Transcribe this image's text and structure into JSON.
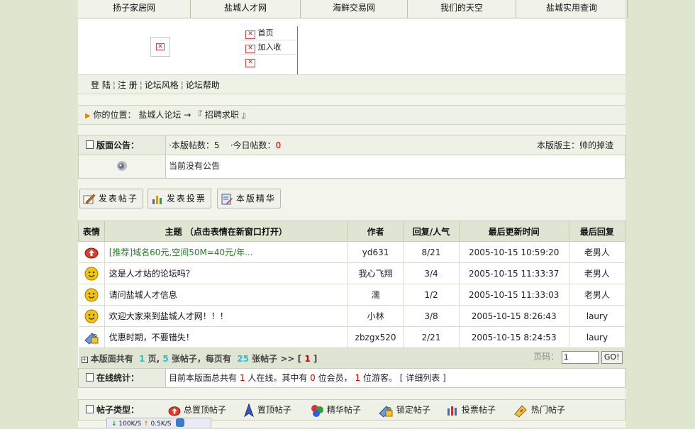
{
  "nav": {
    "tabs": [
      "扬子家居网",
      "盐城人才网",
      "海鲜交易网",
      "我们的天空",
      "盐城实用查询"
    ]
  },
  "banner": {
    "menu": [
      "首页",
      "加入收",
      ""
    ]
  },
  "links": {
    "items": [
      "登 陆",
      "注 册",
      "论坛风格",
      "论坛帮助"
    ]
  },
  "location": {
    "prefix": "你的位置：",
    "forum": "盐城人论坛",
    "arrow": "→",
    "board": "『 招聘求职 』"
  },
  "notice": {
    "header": "版面公告：",
    "stats_label": "·本版帖数：",
    "stats_value": "5",
    "today_label": "·今日帖数：",
    "today_value": "0",
    "moderator": "本版版主：帅的掉渣",
    "content": "当前没有公告"
  },
  "buttons": [
    "发表帖子",
    "发表投票",
    "本版精华"
  ],
  "table": {
    "headers": [
      "表情",
      "主题 （点击表情在新窗口打开）",
      "作者",
      "回复/人气",
      "最后更新时间",
      "最后回复"
    ],
    "rows": [
      {
        "icon": "recommend-icon",
        "subject": "[推荐]域名60元,空间50M=40元/年...",
        "author": "yd631",
        "replies": "8/21",
        "time": "2005-10-15 10:59:20",
        "last": "老男人"
      },
      {
        "icon": "smiley-icon",
        "subject": "这是人才站的论坛吗？",
        "author": "我心飞翔",
        "replies": "3/4",
        "time": "2005-10-15 11:33:37",
        "last": "老男人"
      },
      {
        "icon": "smiley-icon",
        "subject": "请问盐城人才信息",
        "author": "濡",
        "replies": "1/2",
        "time": "2005-10-15 11:33:03",
        "last": "老男人"
      },
      {
        "icon": "smiley-icon",
        "subject": "欢迎大家来到盐城人才网！！！",
        "author": "小林",
        "replies": "3/8",
        "time": "2005-10-15 8:26:43",
        "last": "laury"
      },
      {
        "icon": "lock-icon",
        "subject": "优惠时期，不要错失！",
        "author": "zbzgx520",
        "replies": "2/21",
        "time": "2005-10-15 8:24:53",
        "last": "laury"
      }
    ],
    "footer": {
      "prefix": "本版面共有",
      "pages": "1",
      "pages_unit": "页,",
      "posts": "5",
      "posts_unit": "张帖子，每页有",
      "per_page": "25",
      "per_page_unit": "张帖子 >> [",
      "current": "1",
      "suffix": "]",
      "page_label": "页码：",
      "page_value": "1",
      "go": "GO!"
    }
  },
  "online": {
    "header": "在线统计：",
    "text1": "目前本版面总共有",
    "total": "1",
    "text2": "人在线。其中有",
    "members": "0",
    "text3": "位会员，",
    "guests": "1",
    "text4": "位游客。",
    "detail": "[ 详细列表 ]"
  },
  "types": {
    "header": "帖子类型：",
    "items": [
      "总置顶帖子",
      "置顶帖子",
      "精华帖子",
      "锁定帖子",
      "投票帖子",
      "热门帖子"
    ]
  },
  "status": {
    "down": "100K/S",
    "up": "0.5K/S"
  }
}
